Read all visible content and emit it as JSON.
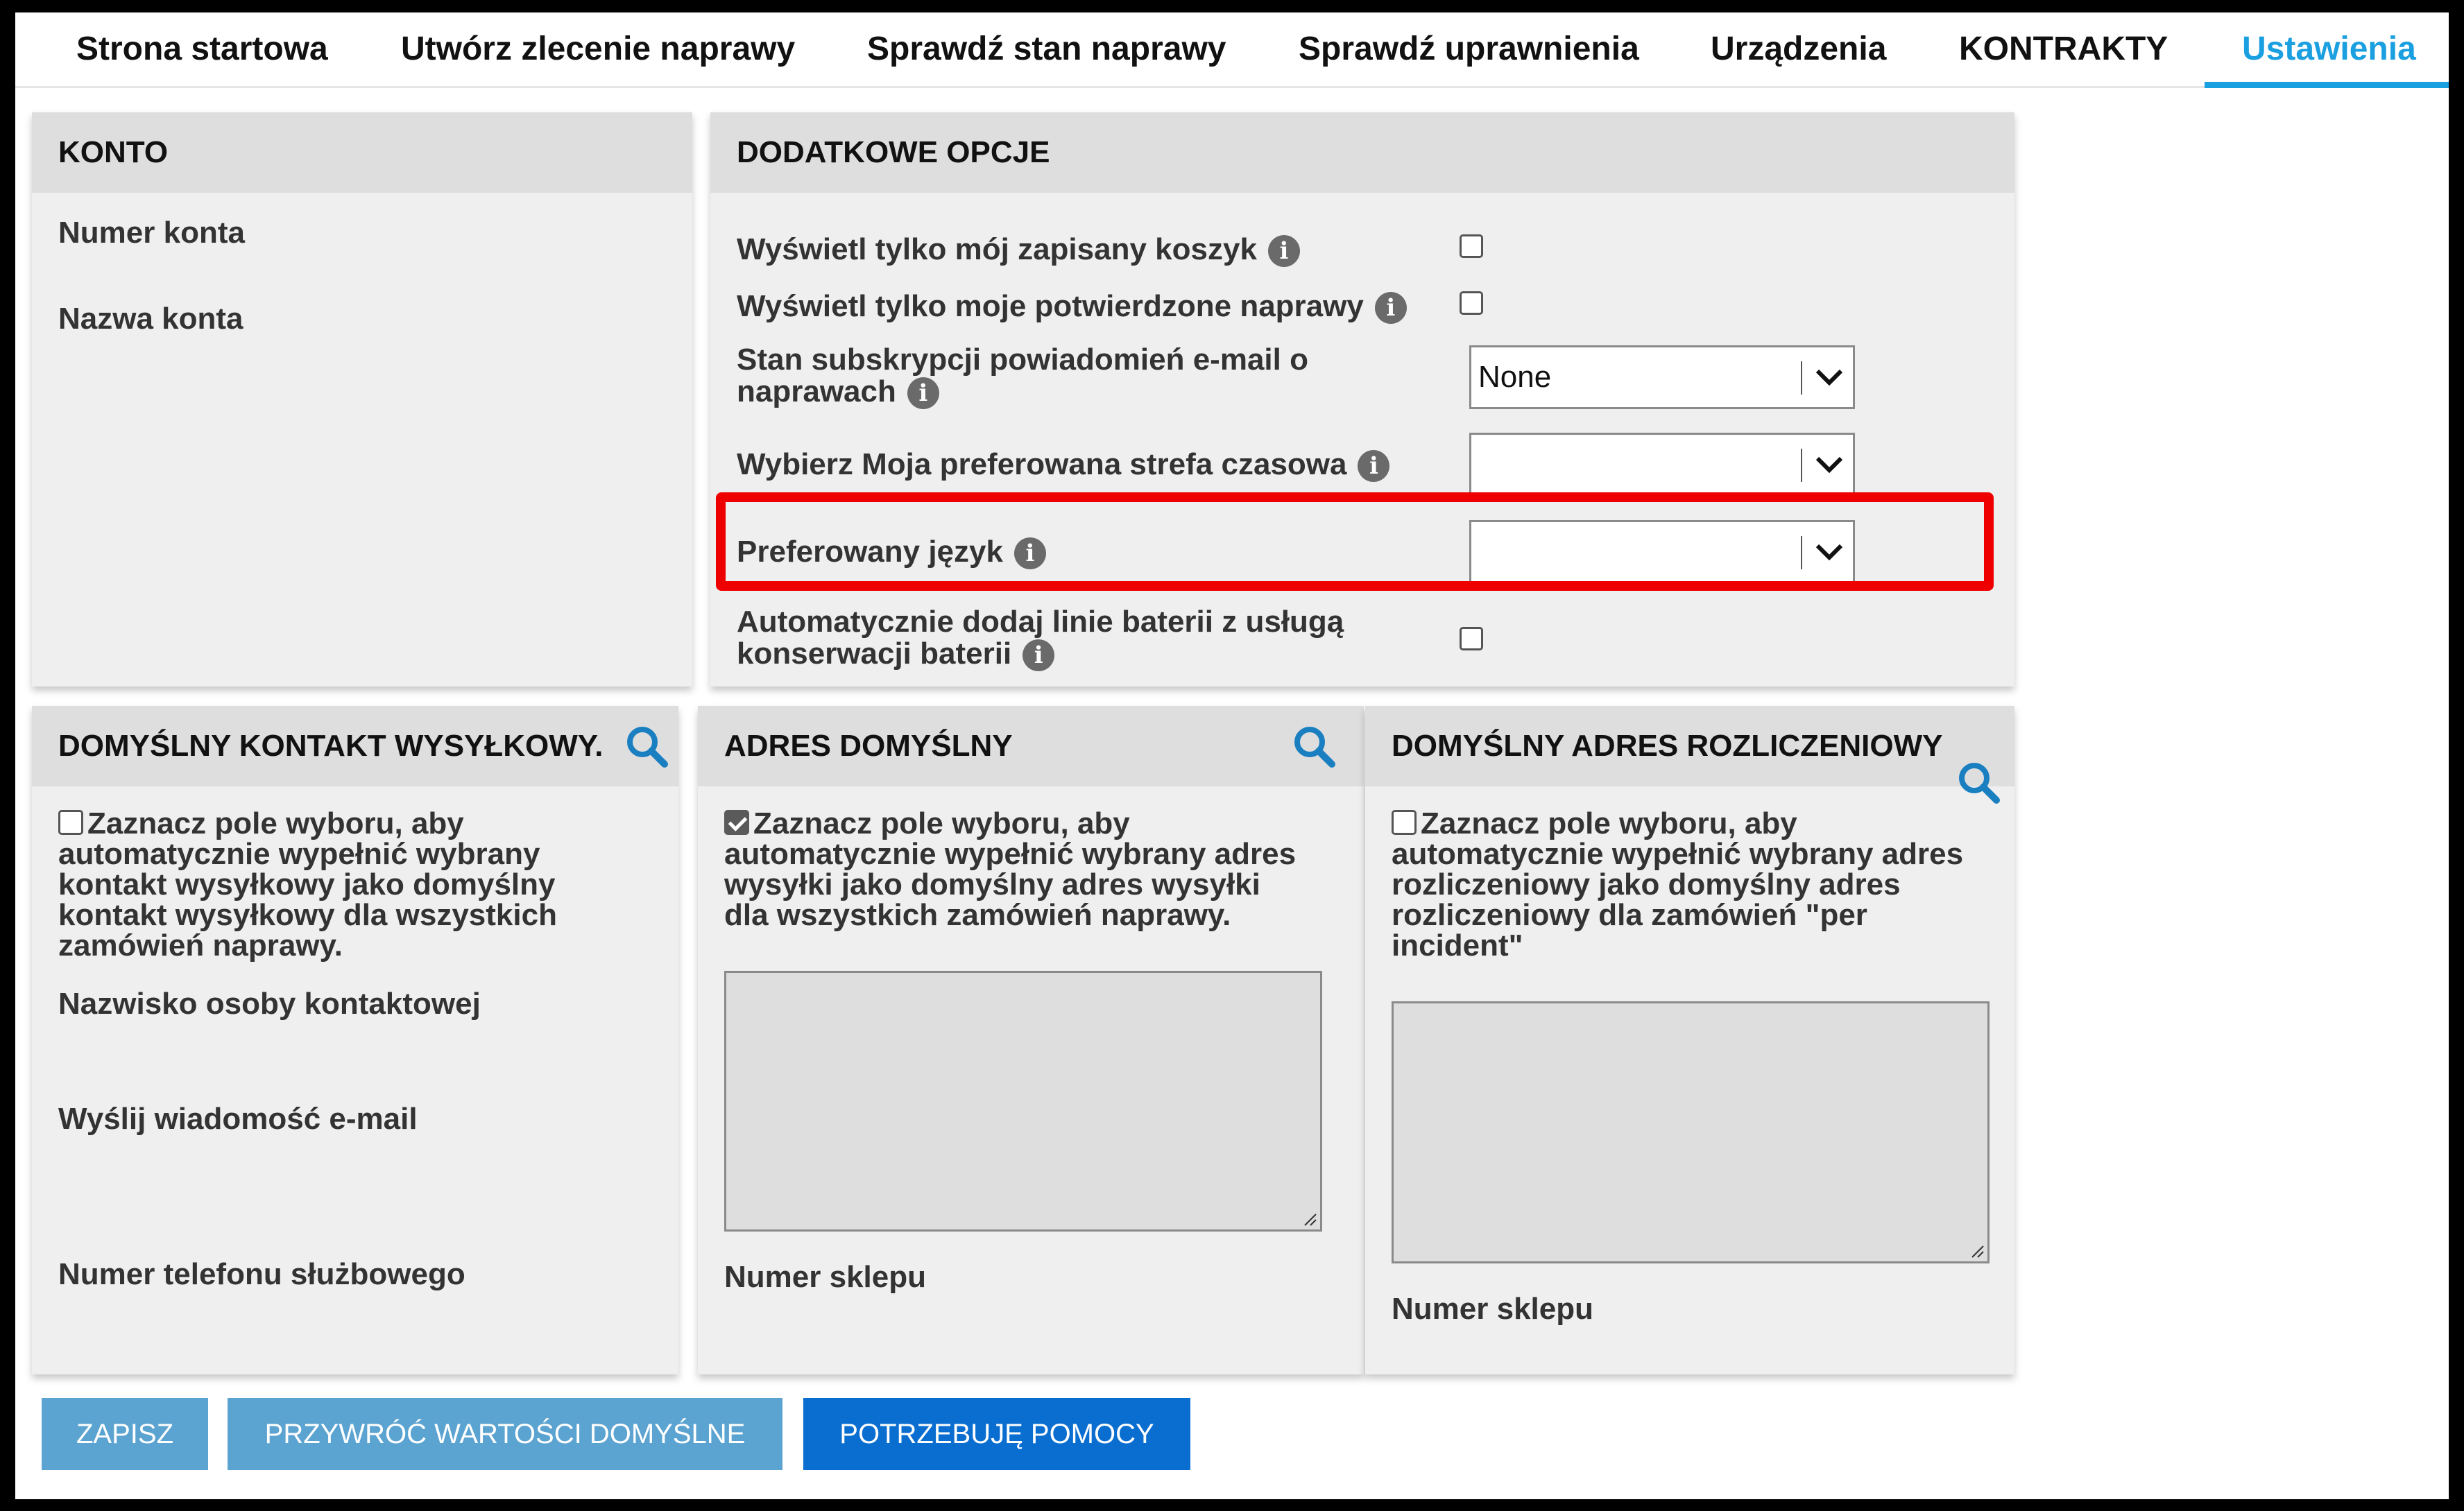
{
  "nav": {
    "items": [
      {
        "label": "Strona startowa"
      },
      {
        "label": "Utwórz zlecenie naprawy"
      },
      {
        "label": "Sprawdź stan naprawy"
      },
      {
        "label": "Sprawdź uprawnienia"
      },
      {
        "label": "Urządzenia"
      },
      {
        "label": "KONTRAKTY"
      },
      {
        "label": "Ustawienia"
      }
    ],
    "active": "Ustawienia"
  },
  "account": {
    "title": "KONTO",
    "account_number_label": "Numer konta",
    "account_name_label": "Nazwa konta"
  },
  "options": {
    "title": "DODATKOWE OPCJE",
    "show_saved_cart": {
      "label": "Wyświetl tylko mój zapisany koszyk",
      "checked": false
    },
    "show_confirmed_repairs": {
      "label": "Wyświetl tylko moje potwierdzone naprawy",
      "checked": false
    },
    "email_subscription": {
      "label_line1": "Stan subskrypcji powiadomień e-mail o",
      "label_line2": "naprawach",
      "value": "None"
    },
    "timezone": {
      "label": "Wybierz Moja preferowana strefa czasowa",
      "value": ""
    },
    "language": {
      "label": "Preferowany język",
      "value": ""
    },
    "battery": {
      "label_line1": "Automatycznie dodaj linie baterii z usługą",
      "label_line2": "konserwacji baterii",
      "checked": false
    },
    "info_glyph": "i"
  },
  "shipping_contact": {
    "title": "DOMYŚLNY KONTAKT WYSYŁKOWY.",
    "checked": false,
    "desc_line1": "Zaznacz pole wyboru, aby",
    "desc_line2": "automatycznie wypełnić wybrany",
    "desc_line3": "kontakt wysyłkowy jako domyślny",
    "desc_line4": "kontakt wysyłkowy dla wszystkich",
    "desc_line5": "zamówień naprawy.",
    "contact_name_label": "Nazwisko osoby kontaktowej",
    "email_label": "Wyślij wiadomość e-mail",
    "phone_label": "Numer telefonu służbowego"
  },
  "default_address": {
    "title": "ADRES DOMYŚLNY",
    "checked": true,
    "desc_line1": "Zaznacz pole wyboru, aby",
    "desc_line2": "automatycznie wypełnić wybrany adres",
    "desc_line3": "wysyłki jako domyślny adres wysyłki",
    "desc_line4": "dla wszystkich zamówień naprawy.",
    "store_label": "Numer sklepu"
  },
  "billing_address": {
    "title": "DOMYŚLNY ADRES ROZLICZENIOWY",
    "checked": false,
    "desc_line1": "Zaznacz pole wyboru, aby",
    "desc_line2": "automatycznie wypełnić wybrany adres",
    "desc_line3": "rozliczeniowy jako domyślny adres",
    "desc_line4": "rozliczeniowy dla zamówień \"per",
    "desc_line5": "incident\"",
    "store_label": "Numer sklepu"
  },
  "buttons": {
    "save": "ZAPISZ",
    "restore_defaults": "PRZYWRÓĆ WARTOŚCI DOMYŚLNE",
    "need_help": "POTRZEBUJĘ POMOCY"
  },
  "colors": {
    "accent": "#1a9fe0",
    "highlight": "#ee0000",
    "button_muted": "#5ba3d0",
    "button_primary": "#0a6ed1"
  }
}
